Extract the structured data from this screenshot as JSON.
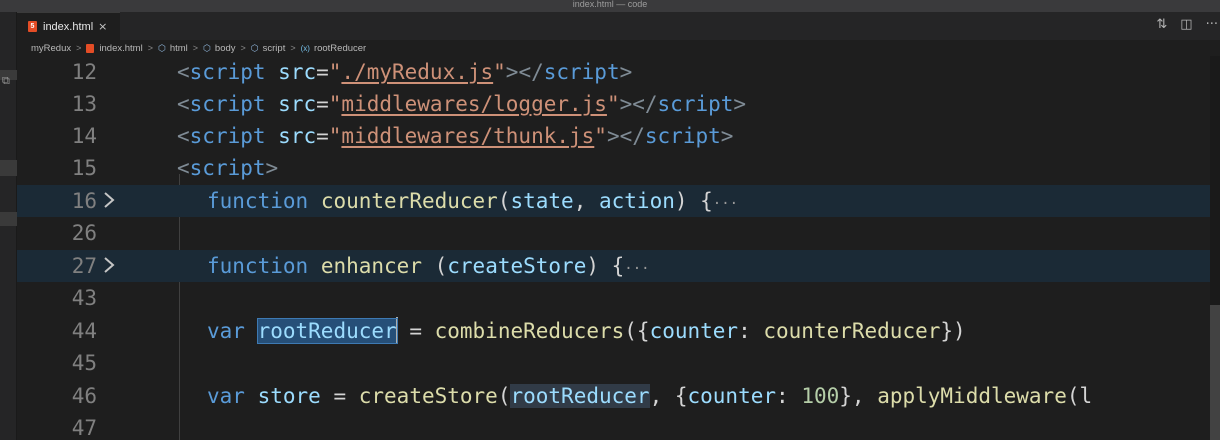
{
  "window": {
    "title": "index.html — code"
  },
  "tab": {
    "label": "index.html",
    "close": "×",
    "icon": "html5-file-icon"
  },
  "editor_actions": {
    "compare": "⇅",
    "split": "◫",
    "more": "···"
  },
  "breadcrumb": [
    "myRedux",
    "index.html",
    "html",
    "body",
    "script",
    "rootReducer"
  ],
  "breadcrumb_sep": ">",
  "lines": [
    {
      "num": "12",
      "folded": false
    },
    {
      "num": "13",
      "folded": false
    },
    {
      "num": "14",
      "folded": false
    },
    {
      "num": "15",
      "folded": false
    },
    {
      "num": "16",
      "folded": true
    },
    {
      "num": "26",
      "folded": false
    },
    {
      "num": "27",
      "folded": true
    },
    {
      "num": "43",
      "folded": false
    },
    {
      "num": "44",
      "folded": false
    },
    {
      "num": "45",
      "folded": false
    },
    {
      "num": "46",
      "folded": false
    },
    {
      "num": "47",
      "folded": false
    }
  ],
  "code": {
    "l12": {
      "open": "<",
      "tag": "script",
      "attr": "src",
      "eq": "=",
      "q": "\"",
      "val": "./myRedux.js",
      "close": "></",
      "ctag": "script",
      "end": ">"
    },
    "l13": {
      "open": "<",
      "tag": "script",
      "attr": "src",
      "eq": "=",
      "q": "\"",
      "val": "middlewares/logger.js",
      "close": "></",
      "ctag": "script",
      "end": ">"
    },
    "l14": {
      "open": "<",
      "tag": "script",
      "attr": "src",
      "eq": "=",
      "q": "\"",
      "val": "middlewares/thunk.js",
      "close": "></",
      "ctag": "script",
      "end": ">"
    },
    "l15": {
      "open": "<",
      "tag": "script",
      "end": ">"
    },
    "l16": {
      "kw": "function",
      "name": "counterReducer",
      "p1": "(",
      "a1": "state",
      "c": ", ",
      "a2": "action",
      "p2": ") {",
      "ell": "···"
    },
    "l27": {
      "kw": "function",
      "name": "enhancer",
      "p1": " (",
      "a1": "createStore",
      "p2": ") {",
      "ell": "···"
    },
    "l44": {
      "kw": "var",
      "name": "rootReducer",
      "eq": " = ",
      "fn": "combineReducers",
      "p1": "({",
      "k": "counter",
      "c": ": ",
      "v": "counterReducer",
      "p2": "})"
    },
    "l46": {
      "kw": "var",
      "name": "store",
      "eq": " = ",
      "fn": "createStore",
      "p1": "(",
      "a1": "rootReducer",
      "c": ", {",
      "k": "counter",
      "c2": ": ",
      "n": "100",
      "c3": "}, ",
      "fn2": "applyMiddleware",
      "p2": "(l"
    }
  },
  "colors": {
    "editor_bg": "#1e1e1e",
    "keyword": "#5a9bd8",
    "function": "#dcdcaa",
    "variable": "#9cdcfe",
    "string": "#ce9178",
    "number": "#b5cea8",
    "selection": "#264f78"
  }
}
